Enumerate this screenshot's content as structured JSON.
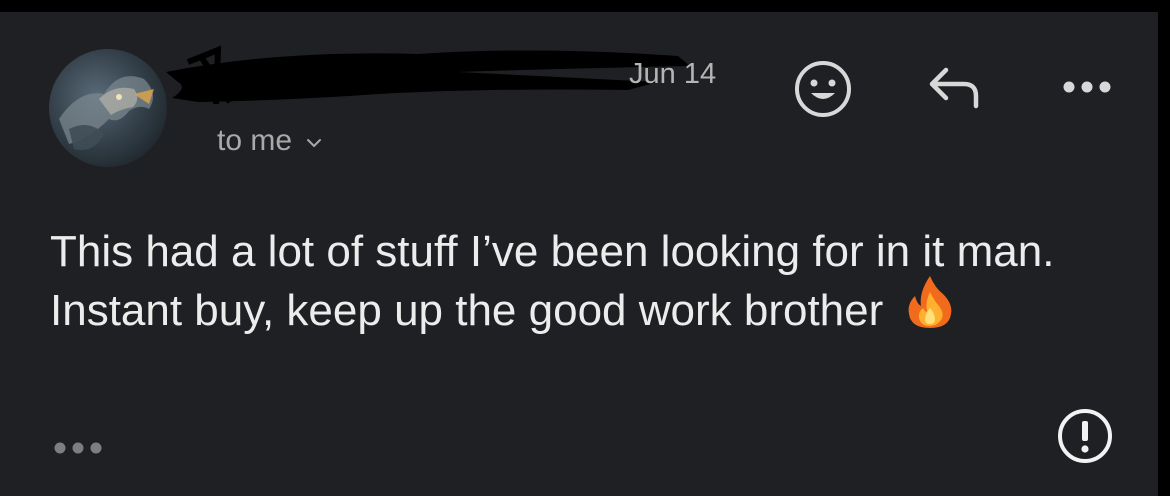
{
  "email": {
    "date": "Jun 14",
    "recipient_label": "to me",
    "body": "This had a lot of stuff I’ve been looking for in it man. Instant buy, keep up the good work brother",
    "body_emoji": "🔥"
  },
  "icons": {
    "emoji_reaction": "smiley-icon",
    "reply": "reply-icon",
    "more": "more-horizontal-icon",
    "show_trimmed": "ellipsis-icon",
    "alert": "exclamation-circle-icon",
    "recipient_details": "chevron-down-icon"
  },
  "colors": {
    "background": "#1f2023",
    "text_primary": "#ececec",
    "text_secondary": "#a9a9a9",
    "icon": "#d8d8d8"
  }
}
